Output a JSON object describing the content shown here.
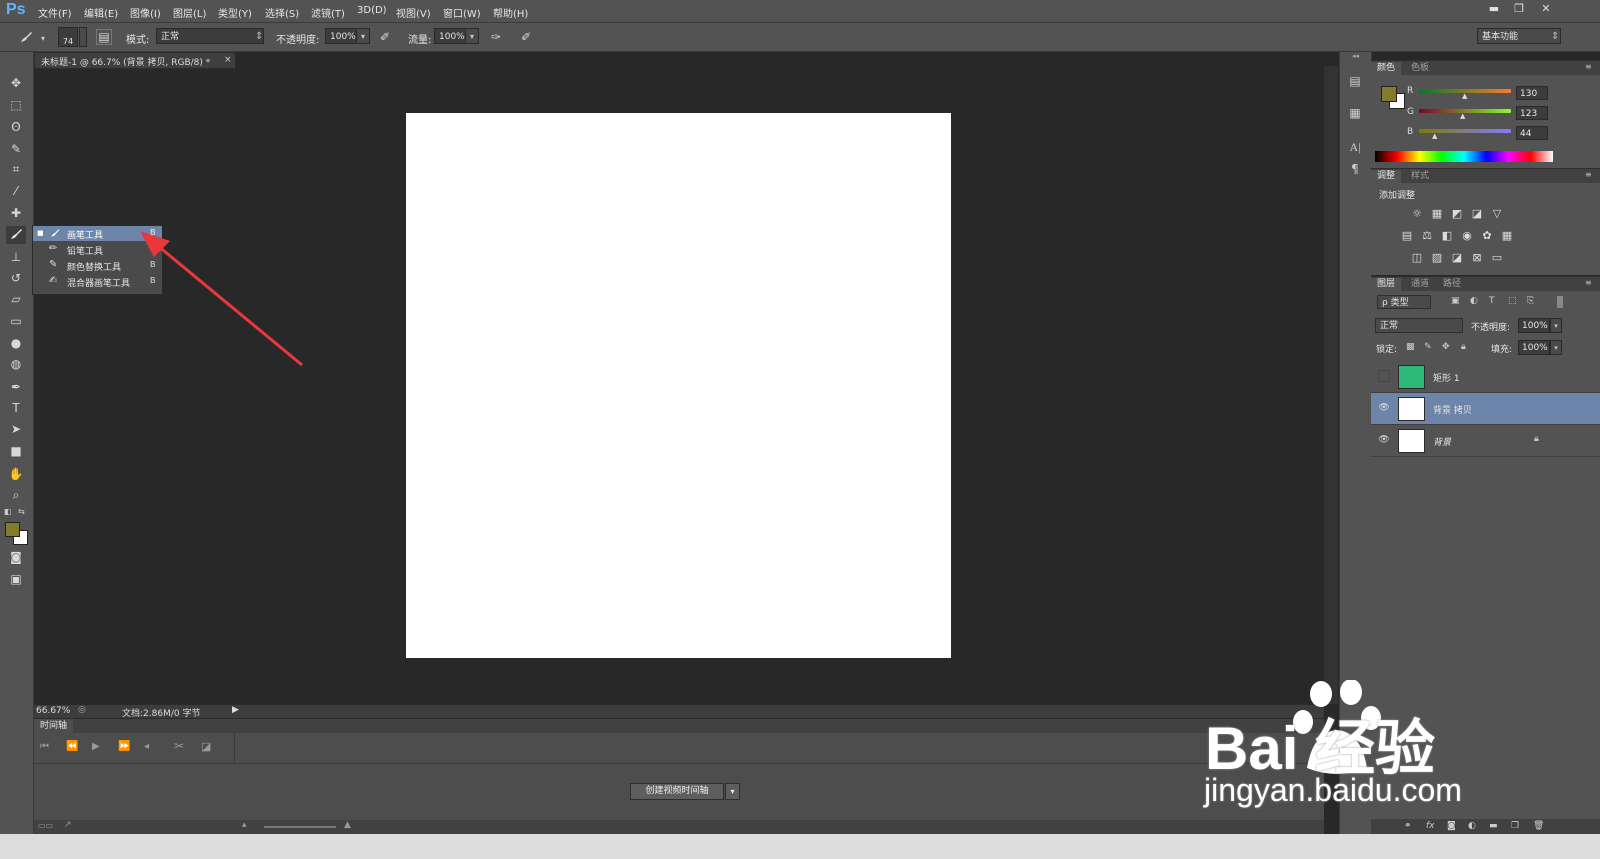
{
  "app": {
    "logo": "Ps"
  },
  "menu": [
    "文件(F)",
    "编辑(E)",
    "图像(I)",
    "图层(L)",
    "类型(Y)",
    "选择(S)",
    "滤镜(T)",
    "3D(D)",
    "视图(V)",
    "窗口(W)",
    "帮助(H)"
  ],
  "window_controls": {
    "minimize": "▬",
    "restore": "❐",
    "close": "✕"
  },
  "options": {
    "brush_size": "74",
    "mode_label": "模式:",
    "mode_value": "正常",
    "opacity_label": "不透明度:",
    "opacity_value": "100%",
    "flow_label": "流量:",
    "flow_value": "100%",
    "workspace": "基本功能"
  },
  "document": {
    "tab_title": "未标题-1 @ 66.7% (背景 拷贝, RGB/8) *",
    "tab_close": "×",
    "zoom": "66.67%",
    "doc_info": "文档:2.86M/0 字节"
  },
  "flyout": {
    "items": [
      {
        "label": "画笔工具",
        "shortcut": "B"
      },
      {
        "label": "铅笔工具",
        "shortcut": "B"
      },
      {
        "label": "颜色替换工具",
        "shortcut": "B"
      },
      {
        "label": "混合器画笔工具",
        "shortcut": "B"
      }
    ]
  },
  "timeline": {
    "title": "时间轴",
    "create_button": "创建视频时间轴"
  },
  "color_panel": {
    "tabs": [
      "颜色",
      "色板"
    ],
    "r_label": "R",
    "r_value": "130",
    "g_label": "G",
    "g_value": "123",
    "b_label": "B",
    "b_value": "44",
    "fg_color": "#827b2c",
    "bg_color": "#ffffff"
  },
  "adjustments_panel": {
    "tabs": [
      "调整",
      "样式"
    ],
    "add_label": "添加调整"
  },
  "layers_panel": {
    "tabs": [
      "图层",
      "通道",
      "路径"
    ],
    "filter_label": "ρ 类型",
    "blend_mode": "正常",
    "opacity_label": "不透明度:",
    "opacity_value": "100%",
    "lock_label": "锁定:",
    "fill_label": "填充:",
    "fill_value": "100%",
    "layers": [
      {
        "name": "矩形 1",
        "visible": false,
        "thumb": "#2eb87a"
      },
      {
        "name": "背景 拷贝",
        "visible": true,
        "thumb": "#ffffff"
      },
      {
        "name": "背景",
        "visible": true,
        "thumb": "#ffffff"
      }
    ]
  },
  "watermark": {
    "brand": "Bai 经验",
    "url": "jingyan.baidu.com"
  },
  "colors": {
    "accent_selection": "#6d85a8",
    "arrow": "#e8383d",
    "rect_layer": "#2eb87a"
  }
}
